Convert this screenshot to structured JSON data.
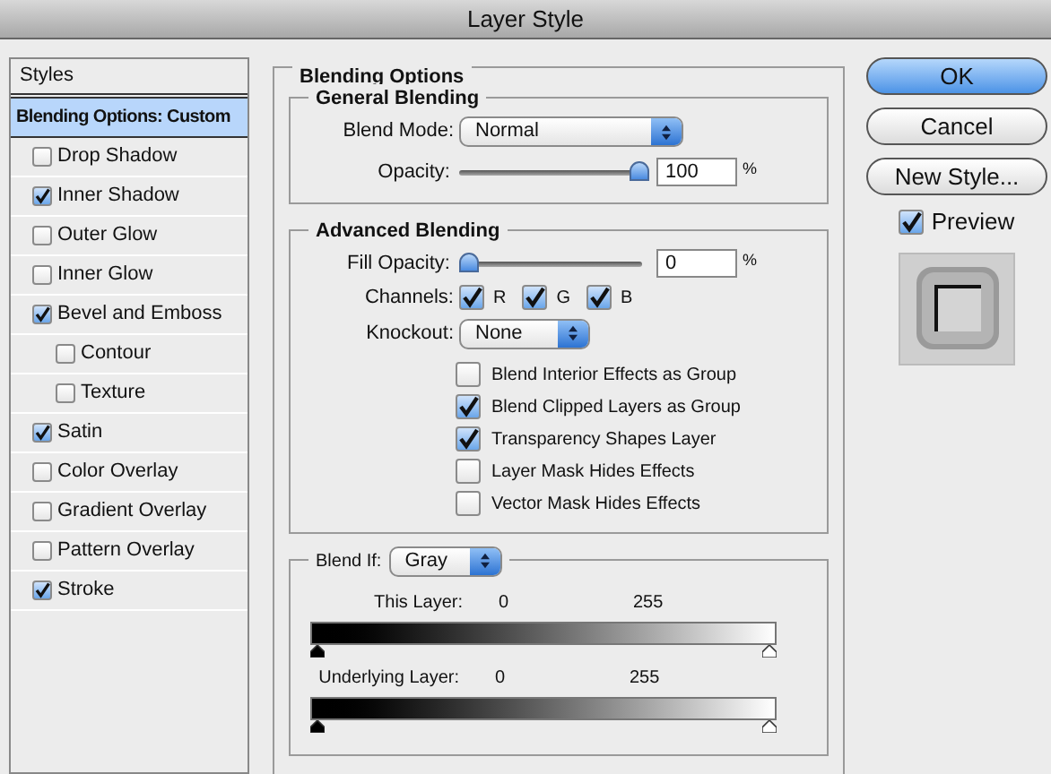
{
  "window": {
    "title": "Layer Style"
  },
  "sidebar": {
    "items": [
      {
        "kind": "header",
        "label": "Styles"
      },
      {
        "kind": "option",
        "label": "Blending Options: Custom",
        "selected": true
      },
      {
        "kind": "effect",
        "label": "Drop Shadow",
        "checked": false,
        "selected": false
      },
      {
        "kind": "effect",
        "label": "Inner Shadow",
        "checked": true,
        "selected": false
      },
      {
        "kind": "effect",
        "label": "Outer Glow",
        "checked": false,
        "selected": false
      },
      {
        "kind": "effect",
        "label": "Inner Glow",
        "checked": false,
        "selected": false
      },
      {
        "kind": "effect",
        "label": "Bevel and Emboss",
        "checked": true,
        "selected": false,
        "children": [
          {
            "kind": "effect",
            "label": "Contour",
            "checked": false,
            "selected": false
          },
          {
            "kind": "effect",
            "label": "Texture",
            "checked": false,
            "selected": false
          }
        ]
      },
      {
        "kind": "effect",
        "label": "Satin",
        "checked": true,
        "selected": false
      },
      {
        "kind": "effect",
        "label": "Color Overlay",
        "checked": false,
        "selected": false
      },
      {
        "kind": "effect",
        "label": "Gradient Overlay",
        "checked": false,
        "selected": false
      },
      {
        "kind": "effect",
        "label": "Pattern Overlay",
        "checked": false,
        "selected": false
      },
      {
        "kind": "effect",
        "label": "Stroke",
        "checked": true,
        "selected": false
      }
    ]
  },
  "blending_options": {
    "title": "Blending Options",
    "general": {
      "title": "General Blending",
      "blend_mode": {
        "label": "Blend Mode:",
        "value": "Normal"
      },
      "opacity": {
        "label": "Opacity:",
        "level": 1,
        "value": "100",
        "unit": "%"
      }
    },
    "advanced": {
      "title": "Advanced Blending",
      "fill_opacity": {
        "label": "Fill Opacity:",
        "level": 0,
        "value": "0",
        "unit": "%"
      },
      "channels": {
        "label": "Channels:",
        "items": [
          {
            "label": "R",
            "checked": true
          },
          {
            "label": "G",
            "checked": true
          },
          {
            "label": "B",
            "checked": true
          }
        ]
      },
      "knockout": {
        "label": "Knockout:",
        "value": "None"
      },
      "options": [
        {
          "label": "Blend Interior Effects as Group",
          "checked": false
        },
        {
          "label": "Blend Clipped Layers as Group",
          "checked": true
        },
        {
          "label": "Transparency Shapes Layer",
          "checked": true
        },
        {
          "label": "Layer Mask Hides Effects",
          "checked": false
        },
        {
          "label": "Vector Mask Hides Effects",
          "checked": false
        }
      ]
    },
    "blend_if": {
      "label": "Blend If:",
      "value": "Gray",
      "sliders": [
        {
          "label": "This Layer:",
          "low": "0",
          "high": "255",
          "thumbs": [
            {
              "level": 0
            },
            {
              "level": 1
            }
          ]
        },
        {
          "label": "Underlying Layer:",
          "low": "0",
          "high": "255",
          "thumbs": [
            {
              "level": 0
            },
            {
              "level": 1
            }
          ]
        }
      ]
    }
  },
  "buttons": [
    {
      "label": "OK",
      "default": true
    },
    {
      "label": "Cancel",
      "default": false
    },
    {
      "label": "New Style...",
      "default": false
    }
  ],
  "preview": {
    "label": "Preview",
    "checked": true
  }
}
